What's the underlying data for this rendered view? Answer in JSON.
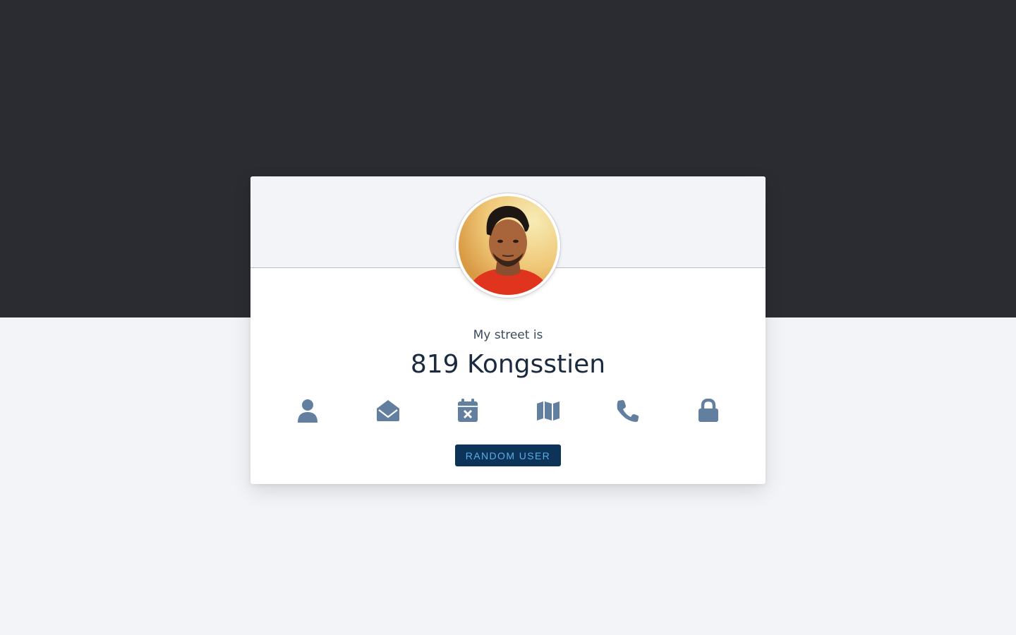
{
  "profile": {
    "label": "My street is",
    "value": "819 Kongsstien"
  },
  "icons": [
    {
      "name": "user-icon"
    },
    {
      "name": "envelope-open-icon"
    },
    {
      "name": "calendar-x-icon"
    },
    {
      "name": "map-icon"
    },
    {
      "name": "phone-icon"
    },
    {
      "name": "lock-icon"
    }
  ],
  "button": {
    "label": "RANDOM USER"
  },
  "colors": {
    "dark_background": "#2b2c31",
    "light_background": "#f3f4f8",
    "icon_color": "#627fa0",
    "button_background": "#0d3358",
    "button_text": "#58aee8"
  }
}
